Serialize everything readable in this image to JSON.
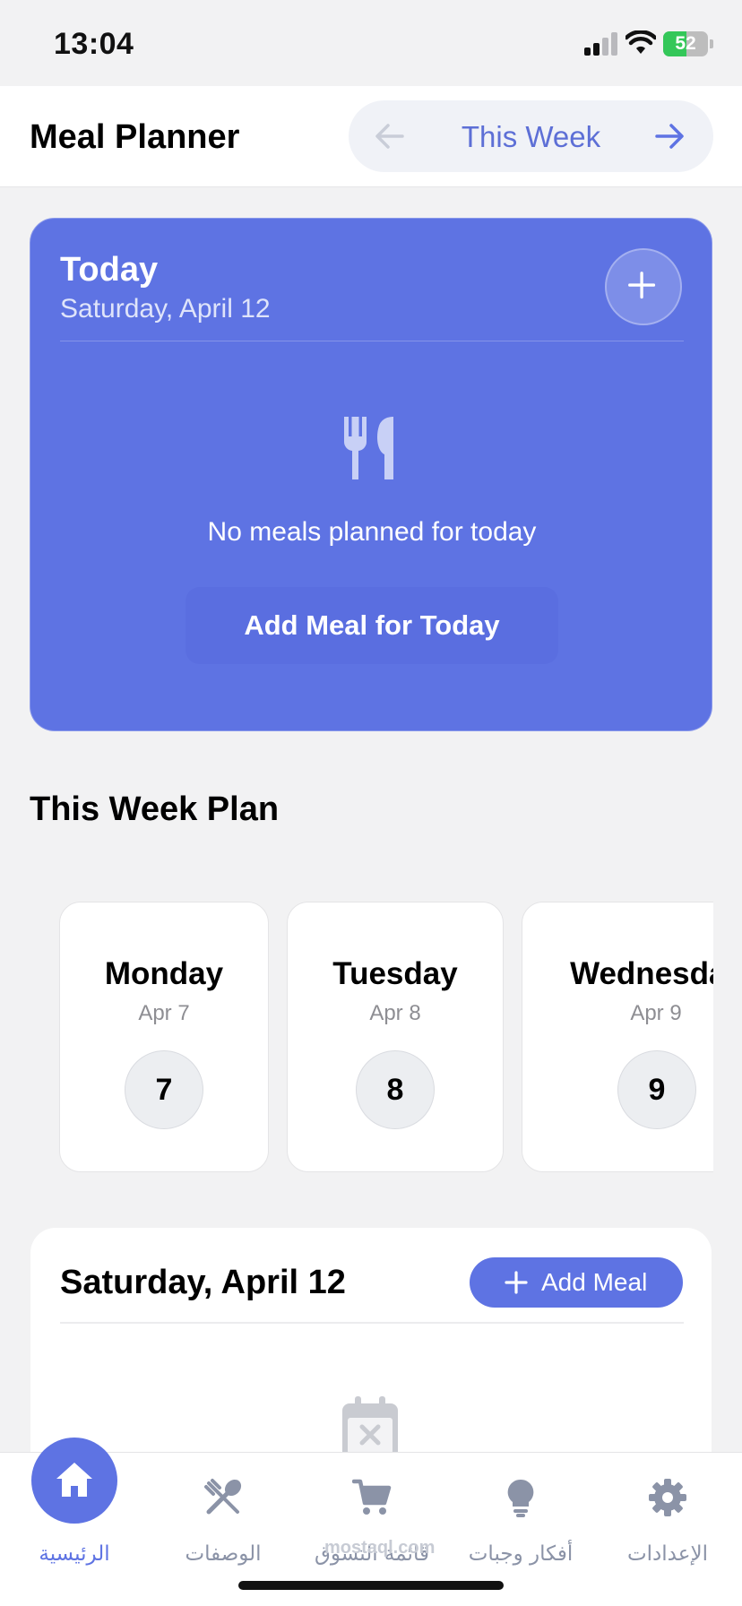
{
  "status": {
    "time": "13:04",
    "battery": "52",
    "battery_level": 0.52
  },
  "header": {
    "title": "Meal Planner",
    "week_label": "This Week"
  },
  "today": {
    "title": "Today",
    "date": "Saturday, April 12",
    "empty_text": "No meals planned for today",
    "add_button": "Add Meal for Today"
  },
  "section": {
    "title": "This Week Plan"
  },
  "days": [
    {
      "name": "Monday",
      "date": "Apr 7",
      "num": "7"
    },
    {
      "name": "Tuesday",
      "date": "Apr 8",
      "num": "8"
    },
    {
      "name": "Wednesday",
      "date": "Apr 9",
      "num": "9"
    }
  ],
  "day_panel": {
    "title": "Saturday, April 12",
    "add_button": "Add Meal"
  },
  "tabs": [
    {
      "label": "الرئيسية",
      "icon": "home-icon",
      "active": true
    },
    {
      "label": "الوصفات",
      "icon": "utensils-icon",
      "active": false
    },
    {
      "label": "قائمة التسوق",
      "icon": "cart-icon",
      "active": false
    },
    {
      "label": "أفكار وجبات",
      "icon": "lightbulb-icon",
      "active": false
    },
    {
      "label": "الإعدادات",
      "icon": "gear-icon",
      "active": false
    }
  ],
  "watermark": "mostaql.com",
  "colors": {
    "accent": "#5e73e3",
    "tab_inactive": "#8b93a7",
    "background": "#f2f2f3"
  }
}
